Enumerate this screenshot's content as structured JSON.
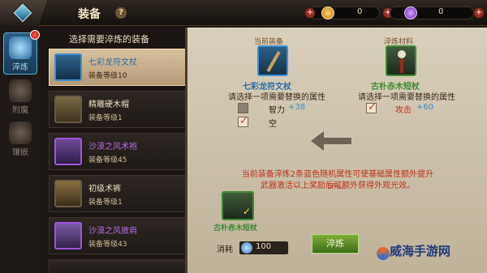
{
  "header": {
    "title": "装备",
    "help": "?",
    "gold_value": "0",
    "gem_value": "0"
  },
  "sidenav": {
    "items": [
      {
        "label": "淬炼",
        "active": true
      },
      {
        "label": "附魔",
        "active": false
      },
      {
        "label": "镶嵌",
        "active": false
      }
    ]
  },
  "list": {
    "header": "选择需要淬炼的装备",
    "items": [
      {
        "name": "七彩龙符文杖",
        "level": "装备等级10",
        "name_color": "#2d6ea8",
        "selected": true
      },
      {
        "name": "精雕硬木帽",
        "level": "装备等级1",
        "name_color": "#e9dcc0",
        "selected": false
      },
      {
        "name": "沙漠之风术袍",
        "level": "装备等级45",
        "name_color": "#b56ae0",
        "selected": false
      },
      {
        "name": "初级术裤",
        "level": "装备等级1",
        "name_color": "#e9dcc0",
        "selected": false
      },
      {
        "name": "沙漠之风披肩",
        "level": "装备等级43",
        "name_color": "#b56ae0",
        "selected": false
      }
    ]
  },
  "main": {
    "current_label": "当前装备",
    "current_name": "七彩龙符文杖",
    "current_hint": "请选择一项需要替换的属性",
    "material_label": "淬炼材料",
    "material_name": "古朴赤木短杖",
    "material_hint": "请选择一项需要替换的属性",
    "attr_left": [
      {
        "name": "智力",
        "value": "+38",
        "checked": false
      },
      {
        "name": "空",
        "value": "",
        "checked": true
      }
    ],
    "attr_right": {
      "name": "攻击",
      "value": "+60",
      "checked": true
    },
    "info_line1": "当前装备淬炼2条蓝色随机属性可使基础属性额外提升5%。",
    "info_line2": "武器激活以上奖励后可额外获得外观光效。",
    "preview_name": "古朴赤木短杖",
    "cost_label": "消耗",
    "cost_value": "100",
    "refine_button": "淬炼"
  },
  "watermark": "威海手游网"
}
